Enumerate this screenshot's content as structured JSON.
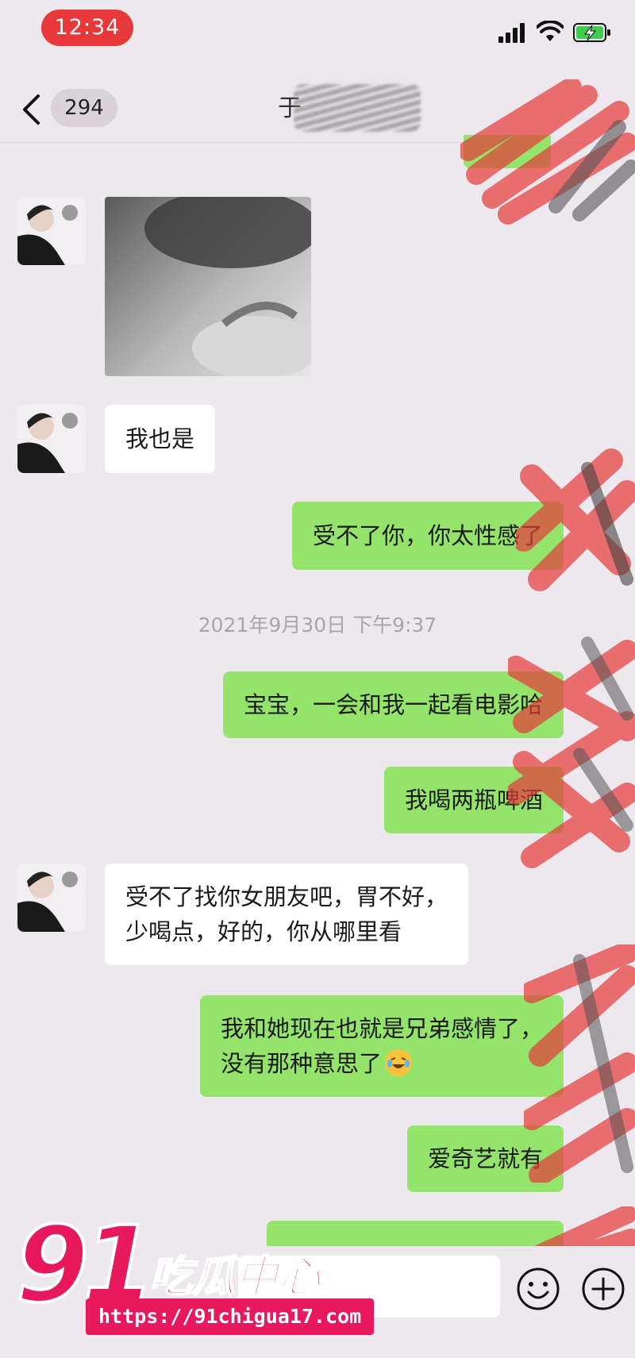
{
  "status_bar": {
    "time": "12:34"
  },
  "nav": {
    "unread_count": "294",
    "title": "于"
  },
  "messages": [
    {
      "side": "in",
      "type": "image"
    },
    {
      "side": "in",
      "text": "我也是"
    },
    {
      "side": "out",
      "text": "受不了你，你太性感了"
    },
    {
      "side": "out",
      "text": "宝宝，一会和我一起看电影哈"
    },
    {
      "side": "out",
      "text": "我喝两瓶啤酒"
    },
    {
      "side": "in",
      "lines": [
        "受不了找你女朋友吧，胃不好，",
        "少喝点，好的，你从哪里看"
      ]
    },
    {
      "side": "out",
      "lines": [
        "我和她现在也就是兄弟感情了，",
        "没有那种意思了"
      ],
      "emoji": "laughing-crying"
    },
    {
      "side": "out",
      "text": "爱奇艺就有"
    }
  ],
  "timestamp": "2021年9月30日 下午9:37",
  "watermark": {
    "number": "91",
    "name": "吃瓜中心",
    "url": "https://91chigua17.com"
  },
  "colors": {
    "outgoing_bubble": "#94e36a",
    "incoming_bubble": "#ffffff",
    "background": "#ede8ed",
    "time_pill": "#e8383a",
    "watermark": "#e8185c"
  }
}
